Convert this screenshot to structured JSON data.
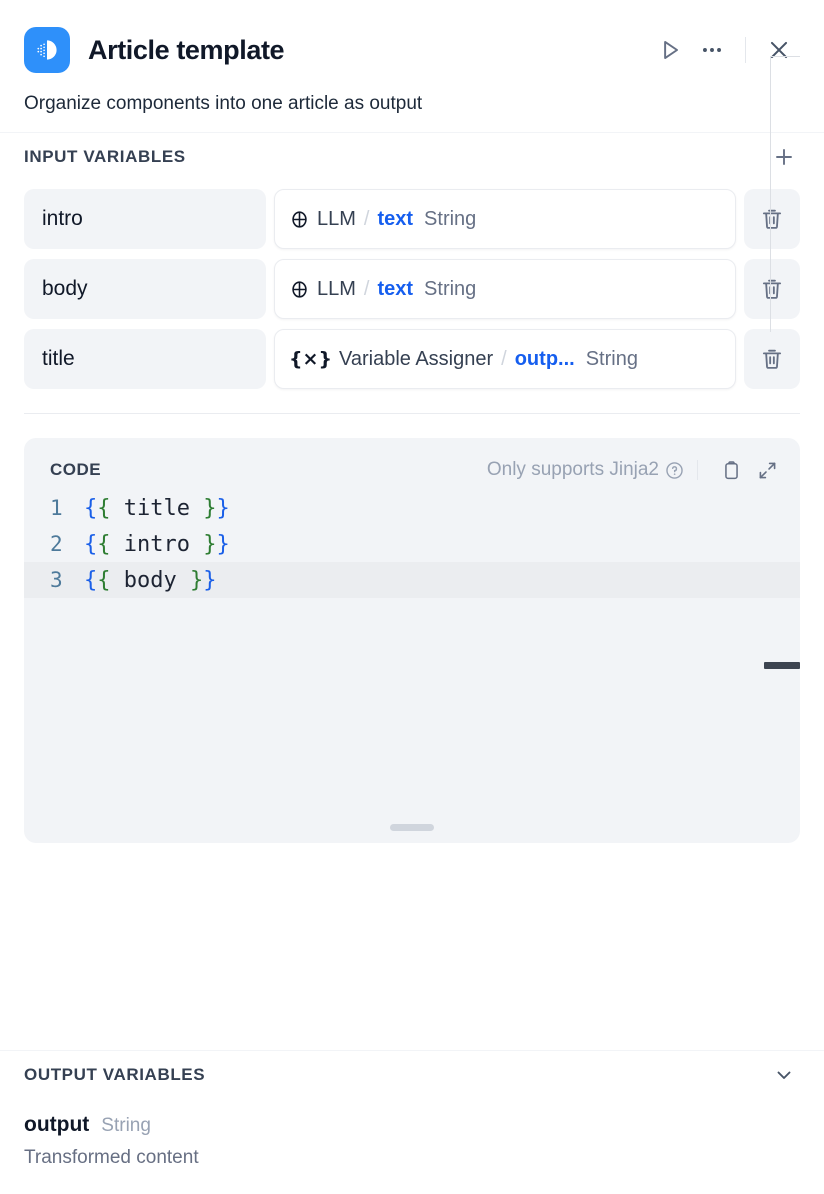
{
  "header": {
    "title": "Article template",
    "icon": "template-transform-icon",
    "icon_bg": "#2e90fa",
    "actions": [
      {
        "name": "run-button",
        "icon": "play-icon"
      },
      {
        "name": "more-options-button",
        "icon": "ellipsis-icon"
      },
      {
        "name": "close-button",
        "icon": "close-icon"
      }
    ]
  },
  "description": "Organize components into one article as output",
  "input_variables": {
    "section_title": "INPUT VARIABLES",
    "add_icon": "plus-icon",
    "delete_icon": "trash-icon",
    "rows": [
      {
        "name": "intro",
        "node_icon": "llm-icon",
        "node": "LLM",
        "separator": "/",
        "variable": "text",
        "type": "String"
      },
      {
        "name": "body",
        "node_icon": "llm-icon",
        "node": "LLM",
        "separator": "/",
        "variable": "text",
        "type": "String"
      },
      {
        "name": "title",
        "node_icon": "variable-assigner-icon",
        "node": "Variable Assigner",
        "separator": "/",
        "variable": "outp...",
        "type": "String"
      }
    ]
  },
  "code": {
    "label": "CODE",
    "hint": "Only supports Jinja2",
    "help_icon": "question-circle-icon",
    "copy_icon": "copy-icon",
    "expand_icon": "expand-icon",
    "lines": [
      {
        "number": "1",
        "outer_open": "{",
        "inner_open": "{",
        "name": " title ",
        "inner_close": "}",
        "outer_close": "}",
        "active": false
      },
      {
        "number": "2",
        "outer_open": "{",
        "inner_open": "{",
        "name": " intro ",
        "inner_close": "}",
        "outer_close": "}",
        "active": false
      },
      {
        "number": "3",
        "outer_open": "{",
        "inner_open": "{",
        "name": " body ",
        "inner_close": "}",
        "outer_close": "}",
        "active": true
      }
    ]
  },
  "output_variables": {
    "section_title": "OUTPUT VARIABLES",
    "collapse_icon": "chevron-down-icon",
    "items": [
      {
        "name": "output",
        "type": "String",
        "description": "Transformed content"
      }
    ]
  },
  "colors": {
    "accent_blue": "#155eef",
    "brand_blue": "#2e90fa",
    "text_primary": "#101828",
    "text_muted": "#667085"
  }
}
